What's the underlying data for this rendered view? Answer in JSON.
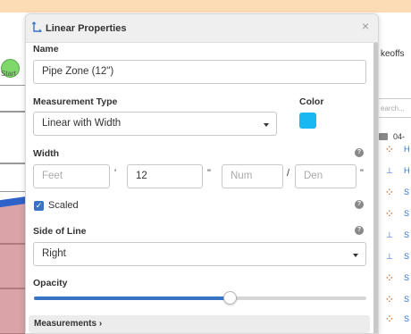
{
  "background": {
    "start_label": "Start",
    "right_title": "keoffs",
    "search_placeholder": "earch...",
    "folder_label": "04-",
    "list": [
      {
        "icon": "count-dots-icon",
        "label": "H"
      },
      {
        "icon": "linear-icon",
        "label": "H"
      },
      {
        "icon": "count-dots-icon",
        "label": "S"
      },
      {
        "icon": "count-dots-icon",
        "label": "S"
      },
      {
        "icon": "linear-icon",
        "label": "S"
      },
      {
        "icon": "linear-icon",
        "label": "S"
      },
      {
        "icon": "count-dots-icon",
        "label": "S"
      },
      {
        "icon": "count-dots-icon",
        "label": "S"
      },
      {
        "icon": "count-dots-icon",
        "label": "S"
      }
    ]
  },
  "panel": {
    "title": "Linear Properties",
    "name": {
      "label": "Name",
      "value": "Pipe Zone (12\")"
    },
    "measurement_type": {
      "label": "Measurement Type",
      "value": "Linear with Width"
    },
    "color": {
      "label": "Color",
      "value": "#1ab8f2"
    },
    "width": {
      "label": "Width",
      "feet_placeholder": "Feet",
      "feet_mark": "'",
      "inches_value": "12",
      "inches_mark": "\"",
      "num_placeholder": "Num",
      "slash": "/",
      "den_placeholder": "Den",
      "fraction_mark": "\""
    },
    "scaled": {
      "label": "Scaled",
      "checked": true
    },
    "side_of_line": {
      "label": "Side of Line",
      "value": "Right"
    },
    "opacity": {
      "label": "Opacity",
      "percent": 59
    },
    "measurements_section": {
      "label": "Measurements",
      "chevron": "›"
    },
    "help_glyph": "?",
    "close_glyph": "×",
    "check_glyph": "✓"
  }
}
